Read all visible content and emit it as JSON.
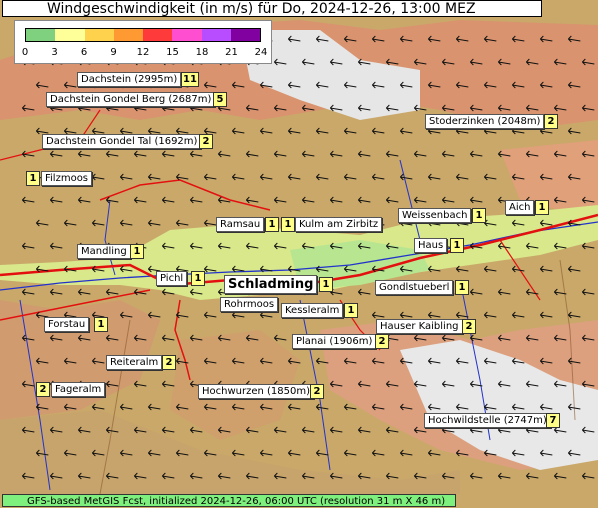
{
  "title": "Windgeschwindigkeit (in m/s) für Do, 2024-12-26, 13:00 MEZ",
  "legend": {
    "ticks": [
      "0",
      "3",
      "6",
      "9",
      "12",
      "15",
      "18",
      "21",
      "24"
    ],
    "colors": [
      "#7fd07f",
      "#ffff99",
      "#ffd24d",
      "#ff9a33",
      "#ff3a3a",
      "#ff4fd0",
      "#b84dff",
      "#8000a0"
    ]
  },
  "locations": [
    {
      "name": "Dachstein (2995m)",
      "value": "11"
    },
    {
      "name": "Dachstein Gondel Berg (2687m)",
      "value": "5"
    },
    {
      "name": "Stoderzinken (2048m)",
      "value": "2"
    },
    {
      "name": "Dachstein Gondel Tal (1692m)",
      "value": "2"
    },
    {
      "name": "Filzmoos",
      "value": "1"
    },
    {
      "name": "Aich",
      "value": "1"
    },
    {
      "name": "Weissenbach",
      "value": "1"
    },
    {
      "name": "Ramsau",
      "value": "1"
    },
    {
      "name": "Kulm am Zirbitz",
      "value": "1"
    },
    {
      "name": "Mandling",
      "value": "1"
    },
    {
      "name": "Haus",
      "value": "1"
    },
    {
      "name": "Pichl",
      "value": "1"
    },
    {
      "name": "Schladming",
      "value": "1"
    },
    {
      "name": "Gondlstueberl",
      "value": "1"
    },
    {
      "name": "Rohrmoos",
      "value": ""
    },
    {
      "name": "Kessleralm",
      "value": "1"
    },
    {
      "name": "Forstau",
      "value": "1"
    },
    {
      "name": "Hauser Kaibling",
      "value": "2"
    },
    {
      "name": "Planai (1906m)",
      "value": "2"
    },
    {
      "name": "Reiteralm",
      "value": "2"
    },
    {
      "name": "Fageralm",
      "value": "2"
    },
    {
      "name": "Hochwurzen (1850m)",
      "value": "2"
    },
    {
      "name": "Hochwildstelle (2747m)",
      "value": "7"
    }
  ],
  "footer": "GFS-based MetGIS Fcst, initialized 2024-12-26, 06:00 UTC  (resolution 31 m X 46 m)"
}
